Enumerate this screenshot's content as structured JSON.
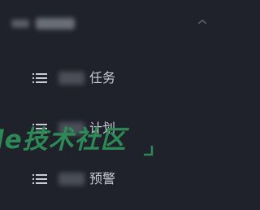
{
  "menu": {
    "items": [
      {
        "label": "任务",
        "icon": "list-icon"
      },
      {
        "label": "计划",
        "icon": "list-icon"
      },
      {
        "label": "预警",
        "icon": "list-icon"
      }
    ]
  },
  "watermark": {
    "text": "le技术社区"
  },
  "colors": {
    "background": "#1f222a",
    "label": "#c8ccd4",
    "icon": "#c8ccd4",
    "watermark": "#2d8a56"
  }
}
